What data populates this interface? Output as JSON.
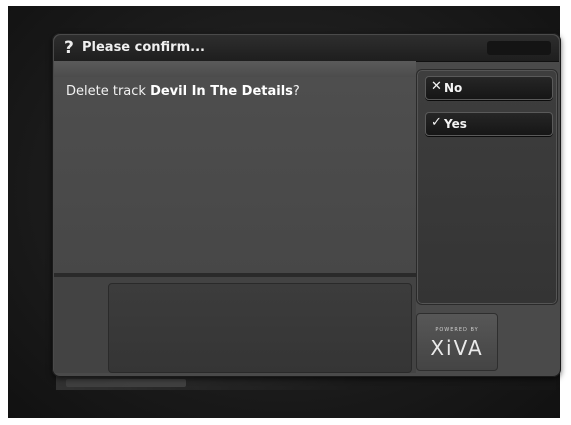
{
  "dialog": {
    "icon": "question-mark-icon",
    "title": "Please confirm...",
    "message_prefix": "Delete track ",
    "message_track": "Devil In The Details",
    "message_suffix": "?"
  },
  "options": [
    {
      "label": "No",
      "icon": "x-icon",
      "icon_glyph": "✕"
    },
    {
      "label": "Yes",
      "icon": "checkmark-icon",
      "icon_glyph": "✓"
    }
  ],
  "logo": {
    "small": "POWERED BY",
    "big": "XiVA"
  },
  "colors": {
    "dialog_bg": "#4a4a4a",
    "title_bar": "#1e1e1e",
    "button_bg": "#1a1a1a",
    "text": "#f2f2f2"
  }
}
